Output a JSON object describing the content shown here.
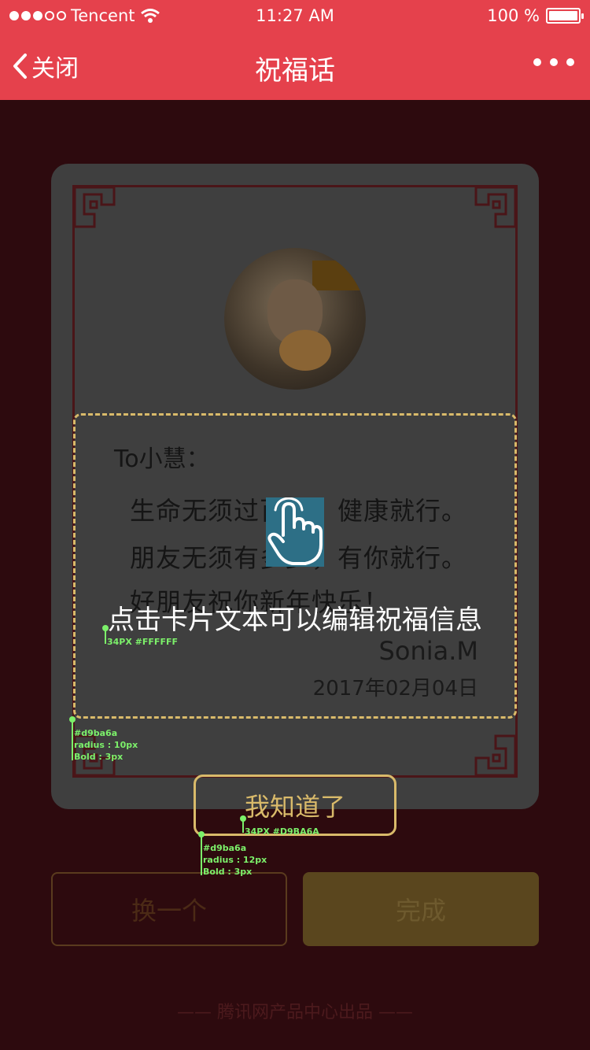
{
  "status_bar": {
    "carrier": "Tencent",
    "time": "11:27 AM",
    "battery": "100 %"
  },
  "nav": {
    "back_label": "关闭",
    "title": "祝福话"
  },
  "card": {
    "to": "To小慧：",
    "lines": [
      "生命无须过百岁，健康就行。",
      "朋友无须有多少，有你就行。",
      "好朋友祝你新年快乐！"
    ],
    "signature": "Sonia.M",
    "date": "2017年02月04日"
  },
  "overlay": {
    "tip": "点击卡片文本可以编辑祝福信息",
    "got_it": "我知道了"
  },
  "buttons": {
    "change": "换一个",
    "done": "完成"
  },
  "footer": "—— 腾讯网产品中心出品 ——",
  "annotations": {
    "tip_spec": "34PX #FFFFFF",
    "box_spec": [
      "#d9ba6a",
      "radius : 10px",
      "Bold : 3px"
    ],
    "gotit_text_spec": "34PX #D9BA6A",
    "gotit_box_spec": [
      "#d9ba6a",
      "radius : 12px",
      "Bold : 3px"
    ]
  },
  "colors": {
    "accent": "#e5414c",
    "gold": "#d9ba6a",
    "spec_green": "#7cf06a"
  },
  "icons": [
    "chevron-left-icon",
    "wifi-icon",
    "battery-icon",
    "more-icon",
    "hand-tap-icon"
  ]
}
